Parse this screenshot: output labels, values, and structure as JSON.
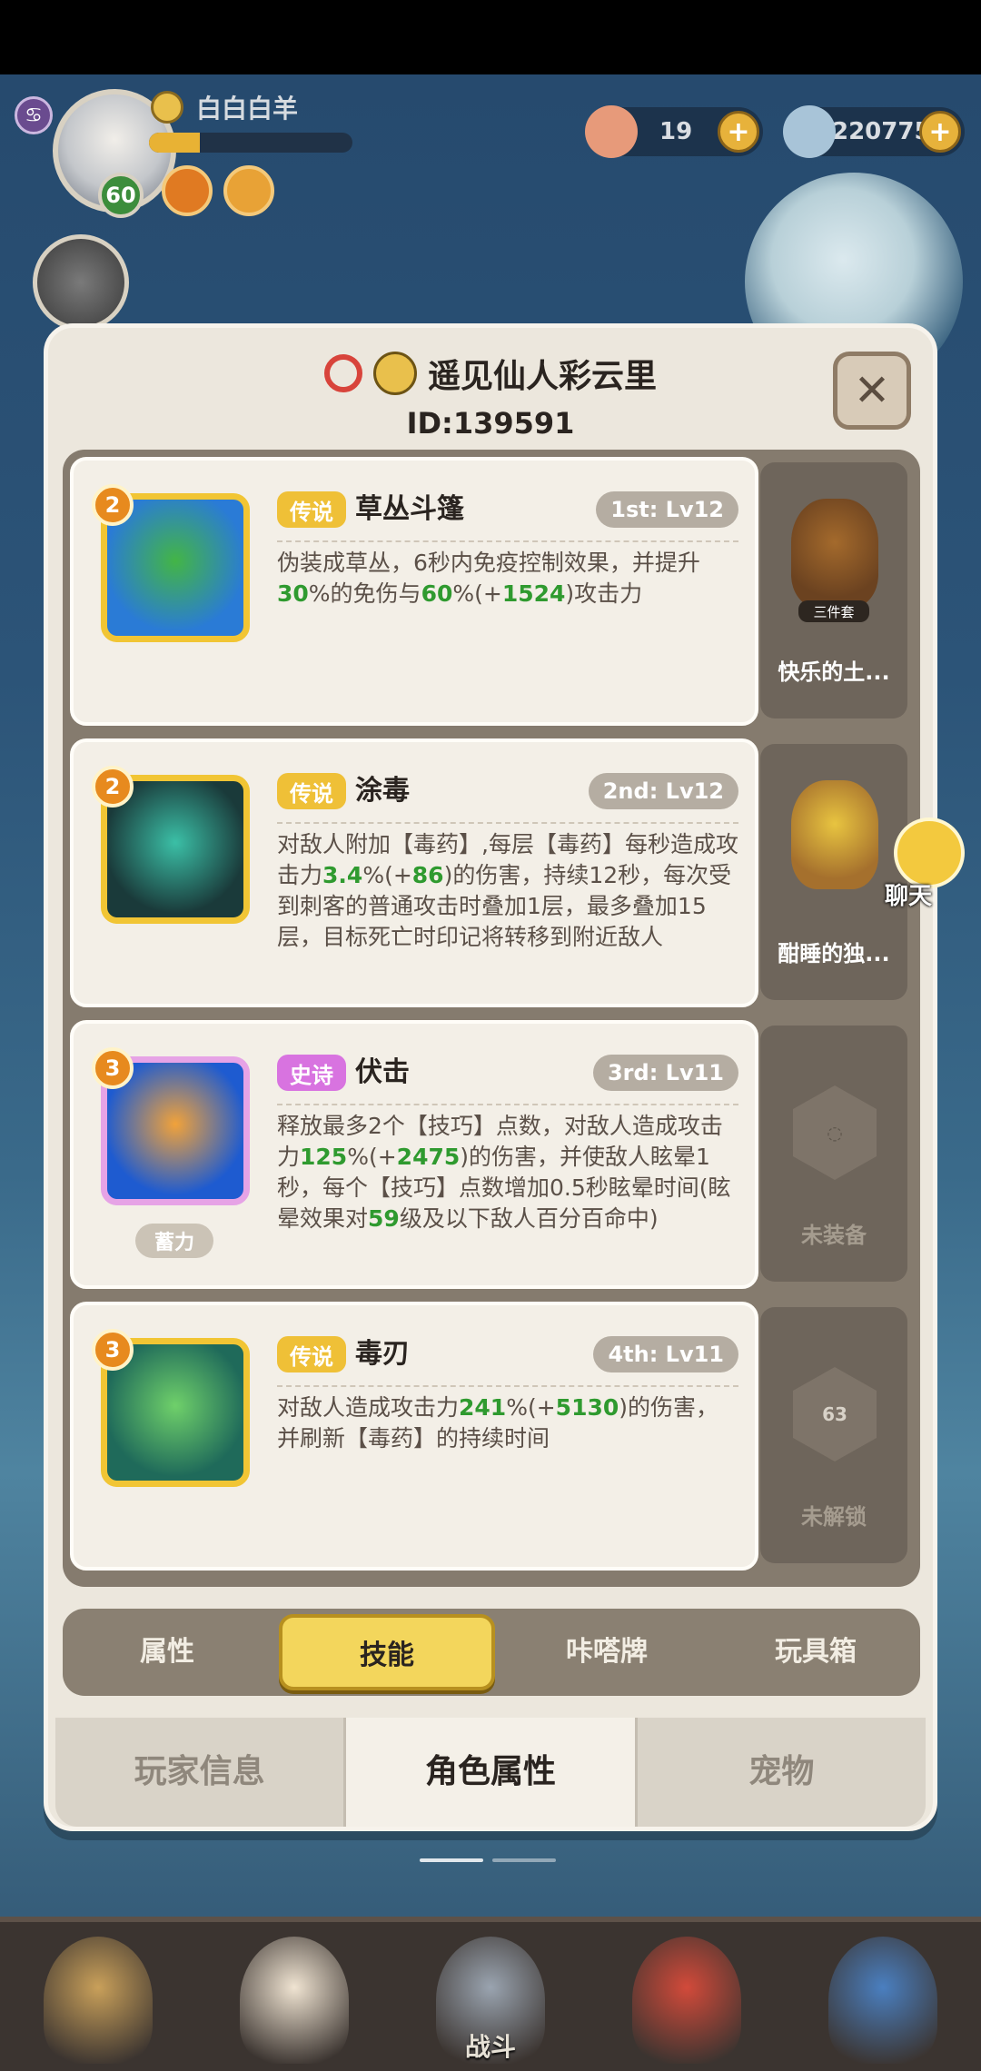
{
  "player": {
    "name": "白白白羊",
    "level": "60",
    "xp_fraction": 0.25
  },
  "resources": [
    {
      "icon": "shell-icon",
      "value": "19"
    },
    {
      "icon": "gem-icon",
      "value": "220775"
    }
  ],
  "panel": {
    "title": "遥见仙人彩云里",
    "id": "ID:139591",
    "close_symbol": "✕"
  },
  "skills": [
    {
      "badge": "2",
      "rarity": "传说",
      "rarity_color": "#efc037",
      "name": "草丛斗篷",
      "slot": "1st: Lv12",
      "icon_colors": [
        "#2a7bd6",
        "#43b546"
      ],
      "desc_parts": [
        "伪装成草丛，6秒内免疫控制效果，并提升",
        "30",
        "%的免伤与",
        "60",
        "%(+",
        "1524",
        ")攻击力"
      ],
      "extra": ""
    },
    {
      "badge": "2",
      "rarity": "传说",
      "rarity_color": "#efc037",
      "name": "涂毒",
      "slot": "2nd: Lv12",
      "icon_colors": [
        "#1a3a3a",
        "#3bbfa6"
      ],
      "desc_parts": [
        "对敌人附加【毒药】,每层【毒药】每秒造成攻击力",
        "3.4",
        "%(+",
        "86",
        ")的伤害，持续12秒，每次受到刺客的普通攻击时叠加1层，最多叠加15层，目标死亡时印记将转移到附近敌人"
      ],
      "extra": ""
    },
    {
      "badge": "3",
      "rarity": "史诗",
      "rarity_color": "#d873e0",
      "name": "伏击",
      "slot": "3rd: Lv11",
      "icon_colors": [
        "#1e5bd0",
        "#f1a23a"
      ],
      "desc_parts": [
        "释放最多2个【技巧】点数，对敌人造成攻击力",
        "125",
        "%(+",
        "2475",
        ")的伤害，并使敌人眩晕1秒，每个【技巧】点数增加0.5秒眩晕时间(眩晕效果对",
        "59",
        "级及以下敌人百分百命中)"
      ],
      "extra": "蓄力"
    },
    {
      "badge": "3",
      "rarity": "传说",
      "rarity_color": "#efc037",
      "name": "毒刃",
      "slot": "4th: Lv11",
      "icon_colors": [
        "#1f6a5a",
        "#6fd06a"
      ],
      "desc_parts": [
        "对敌人造成攻击力",
        "241",
        "%(+",
        "5130",
        ")的伤害，并刷新【毒药】的持续时间"
      ],
      "extra": ""
    }
  ],
  "side_slots": [
    {
      "caption": "快乐的土...",
      "state": "pet",
      "tag": "三件套"
    },
    {
      "caption": "酣睡的独...",
      "state": "pet",
      "tag": ""
    },
    {
      "caption": "未装备",
      "state": "empty",
      "tag": ""
    },
    {
      "caption": "未解锁",
      "state": "locked",
      "tag": "63"
    }
  ],
  "sub_tabs": [
    "属性",
    "技能",
    "咔嗒牌",
    "玩具箱"
  ],
  "active_sub_tab": 1,
  "main_tabs": [
    "玩家信息",
    "角色属性",
    "宠物"
  ],
  "active_main_tab": 1,
  "chat": {
    "label": "聊天"
  },
  "bottom_nav": [
    "",
    "",
    "战斗",
    "",
    ""
  ]
}
